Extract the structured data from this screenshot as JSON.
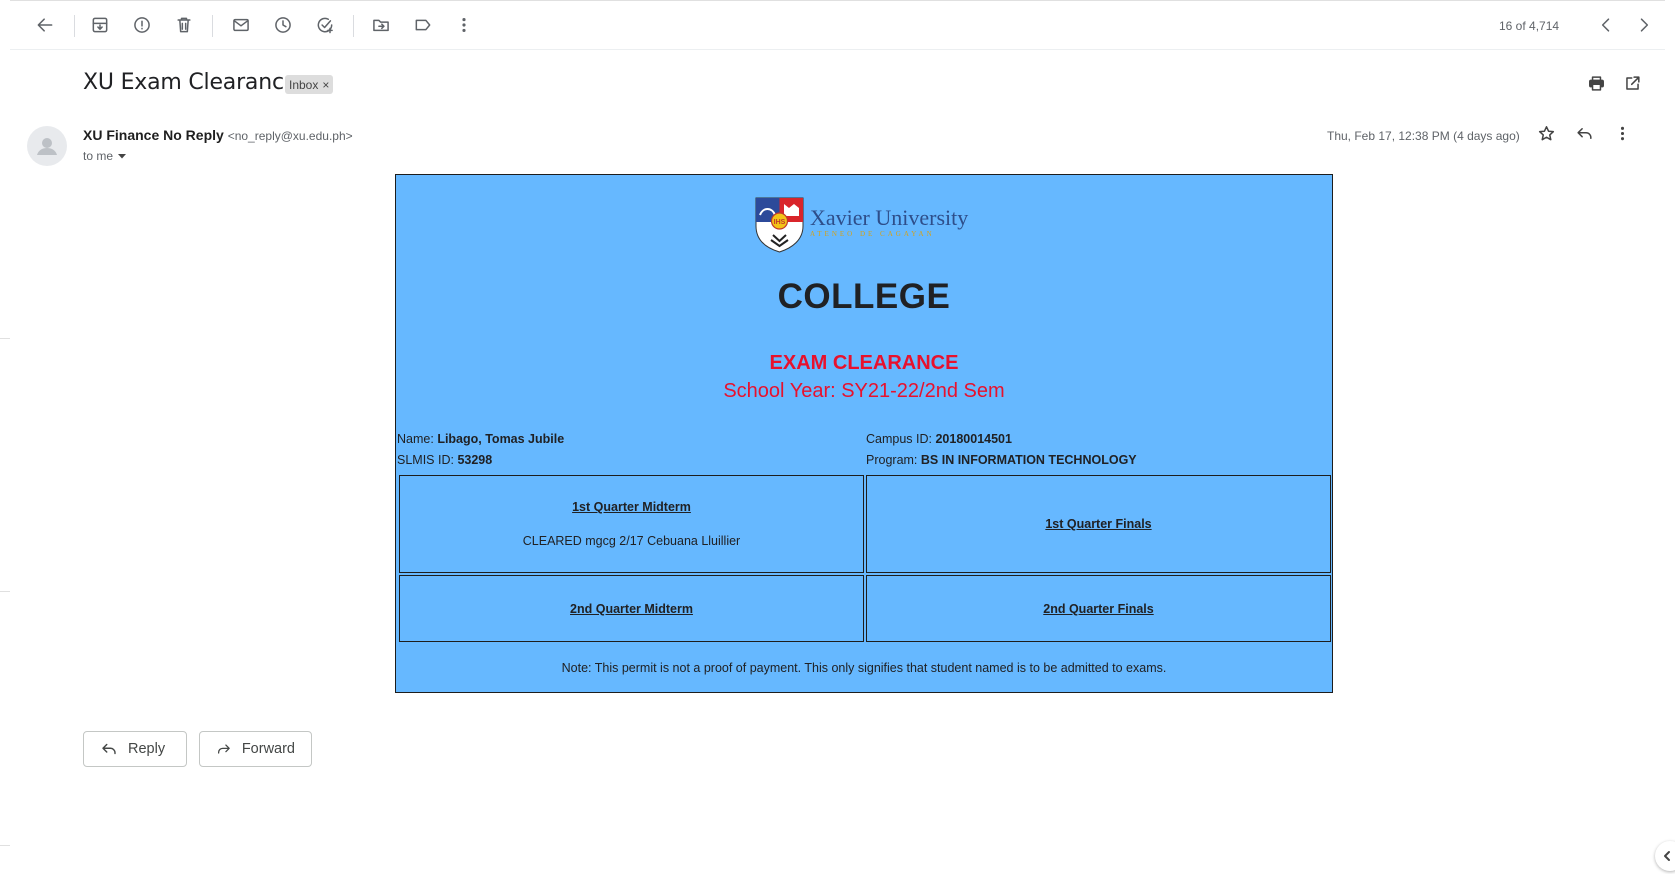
{
  "toolbar": {
    "pager": "16 of 4,714"
  },
  "email": {
    "subject": "XU Exam Clearance",
    "label": "Inbox",
    "label_remove": "×",
    "sender_name": "XU Finance No Reply",
    "sender_email": "<no_reply@xu.edu.ph>",
    "to_me": "to me",
    "date": "Thu, Feb 17, 12:38 PM (4 days ago)"
  },
  "clearance": {
    "logo_title": "Xavier University",
    "logo_subtitle": "ATENEO DE CAGAYAN",
    "heading": "COLLEGE",
    "title": "EXAM CLEARANCE",
    "school_year": "School Year: SY21-22/2nd Sem",
    "name_label": "Name:",
    "name_value": "Libago, Tomas Jubile",
    "slmis_label": "SLMIS ID:",
    "slmis_value": "53298",
    "campus_label": "Campus ID:",
    "campus_value": "20180014501",
    "program_label": "Program:",
    "program_value": "BS IN INFORMATION TECHNOLOGY",
    "q1_midterm": "1st Quarter Midterm",
    "q1_midterm_status": "CLEARED mgcg 2/17 Cebuana Lluillier",
    "q1_finals": "1st Quarter Finals",
    "q2_midterm": "2nd Quarter Midterm",
    "q2_finals": "2nd Quarter Finals",
    "note": "Note: This permit is not a proof of payment. This only signifies that student named is to be admitted to exams."
  },
  "actions": {
    "reply": "Reply",
    "forward": "Forward"
  },
  "colors": {
    "card_bg": "#66b8ff",
    "title_red": "#e8112d"
  }
}
